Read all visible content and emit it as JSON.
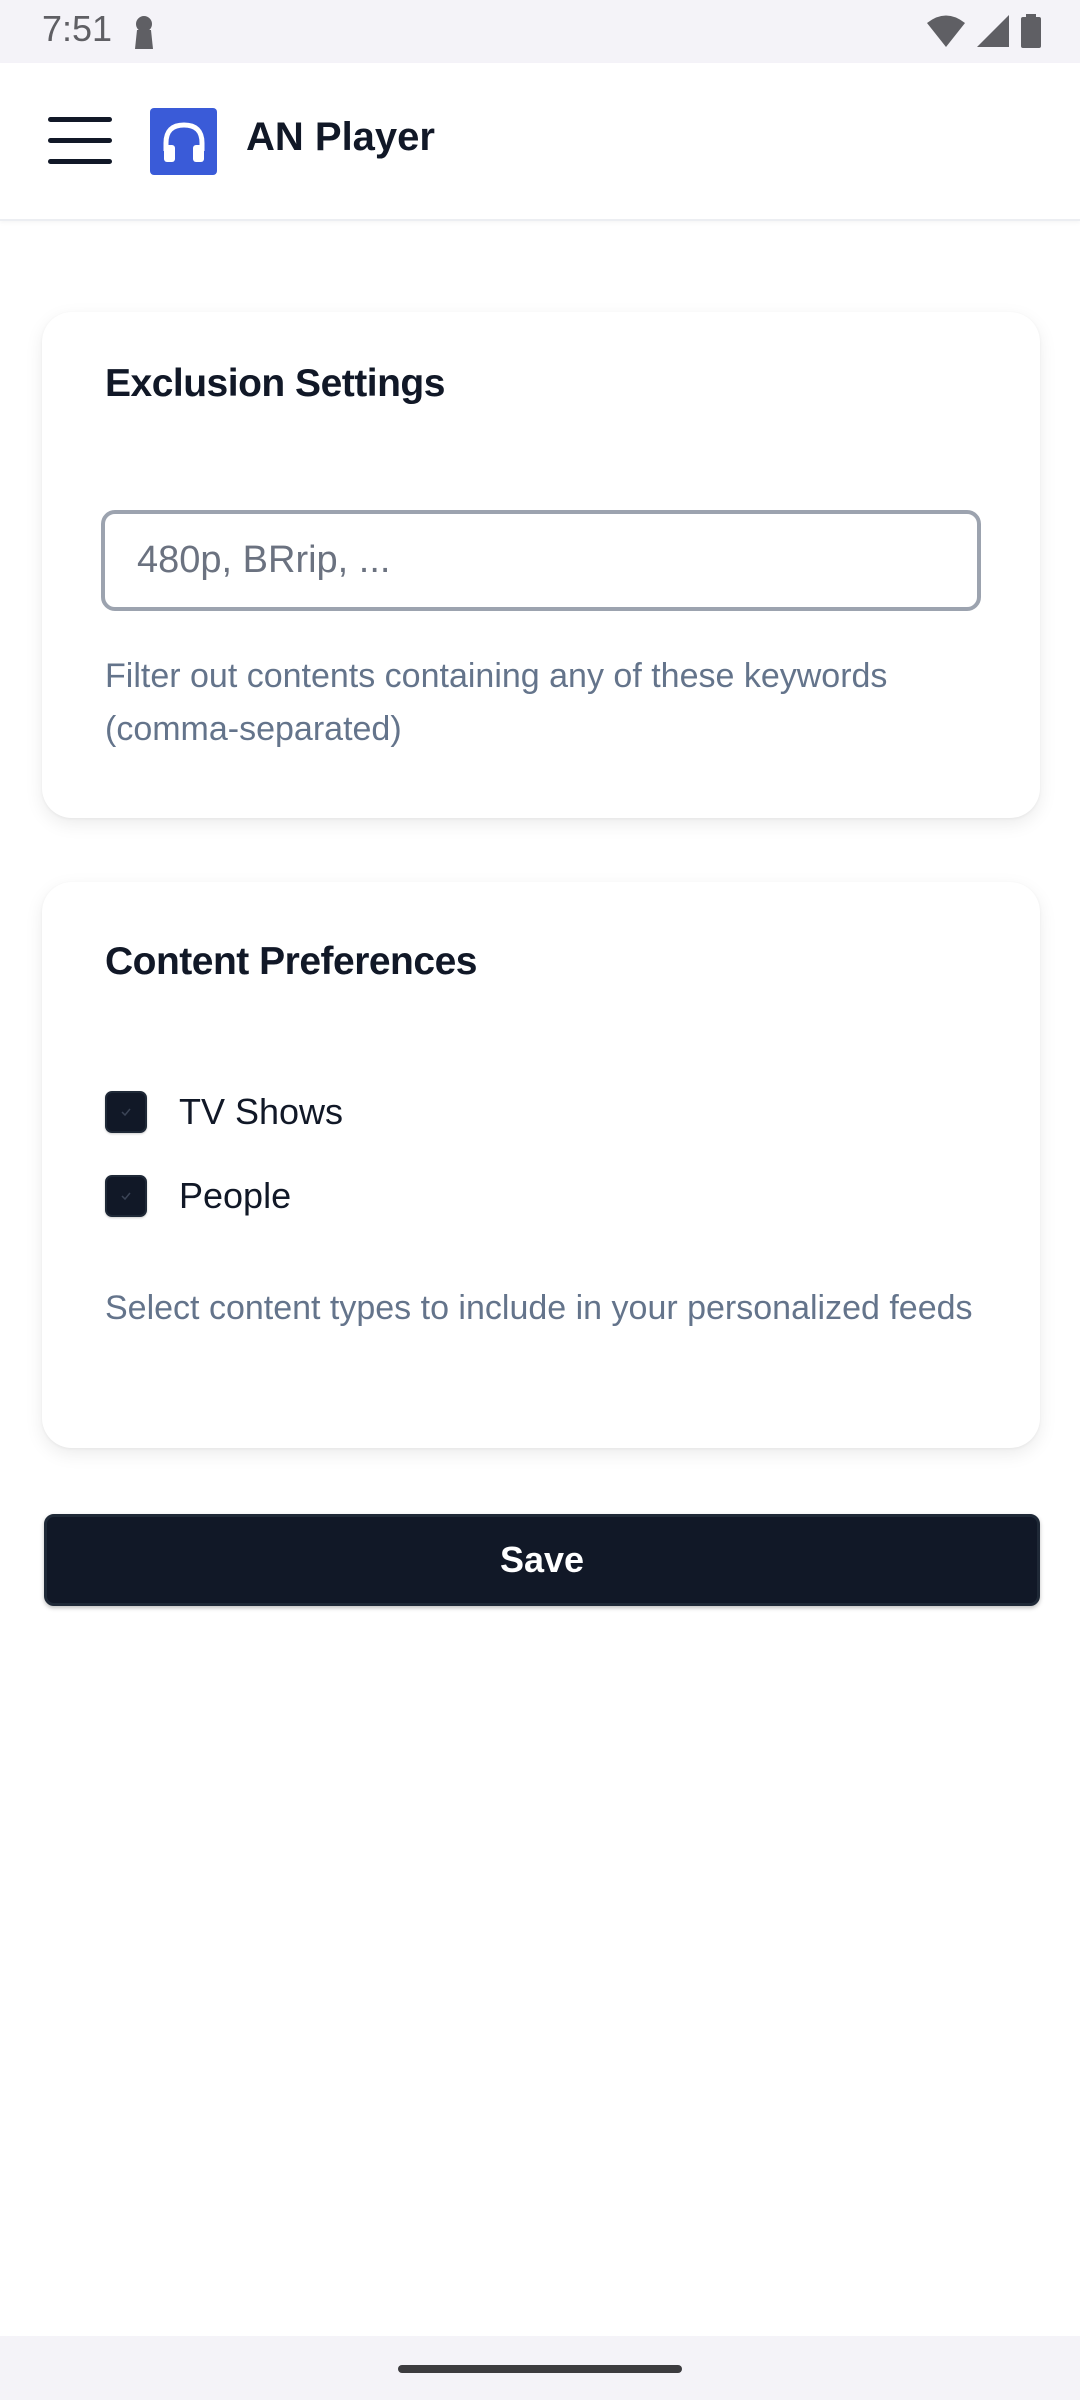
{
  "status_bar": {
    "time": "7:51",
    "icons": [
      "lock-icon",
      "wifi-icon",
      "cell-signal-icon",
      "battery-icon"
    ]
  },
  "app_bar": {
    "title": "AN Player",
    "menu_icon": "hamburger-menu-icon",
    "logo_icon": "headphones-icon",
    "logo_color": "#3a5bd8"
  },
  "exclusion": {
    "title": "Exclusion Settings",
    "input_value": "",
    "input_placeholder": "480p, BRrip, ...",
    "helper": "Filter out contents containing any of these keywords (comma-separated)"
  },
  "preferences": {
    "title": "Content Preferences",
    "options": [
      {
        "label": "TV Shows",
        "checked": true
      },
      {
        "label": "People",
        "checked": true
      }
    ],
    "helper": "Select content types to include in your personalized feeds"
  },
  "actions": {
    "save_label": "Save"
  },
  "colors": {
    "primary": "#111827",
    "helper_text": "#64748b",
    "brand": "#3a5bd8"
  }
}
